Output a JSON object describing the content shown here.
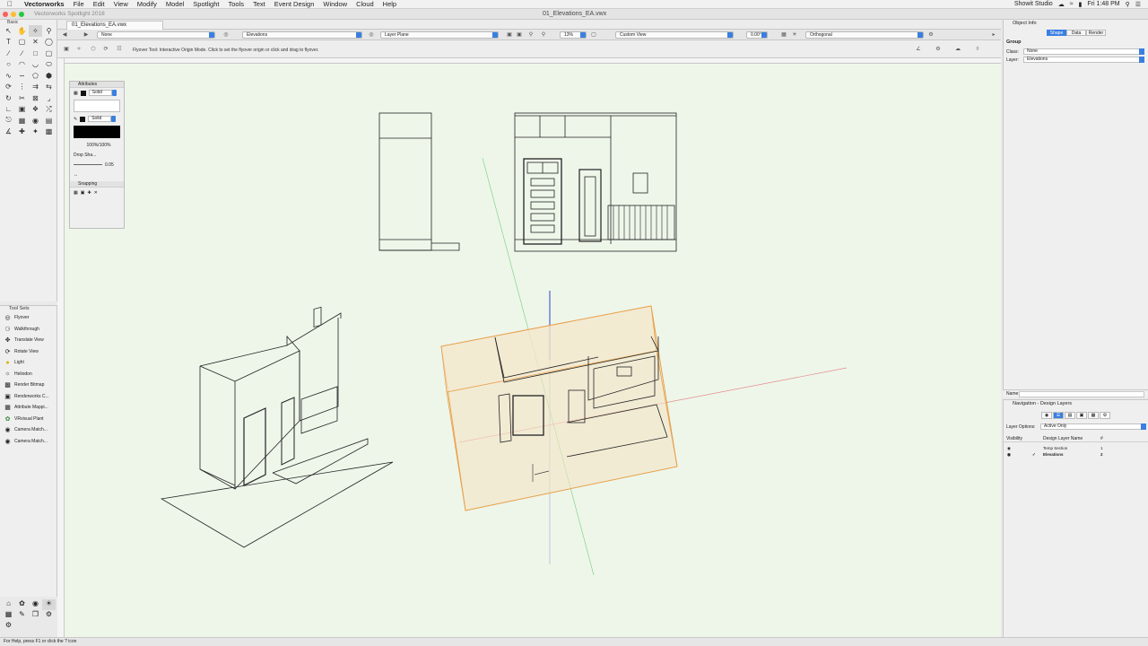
{
  "menubar": {
    "app": "Vectorworks",
    "items": [
      "File",
      "Edit",
      "View",
      "Modify",
      "Model",
      "Spotlight",
      "Tools",
      "Text",
      "Event Design",
      "Window",
      "Cloud",
      "Help"
    ],
    "clock": "Fri 1:48 PM",
    "status_text": "Showit Studio"
  },
  "titlebar": {
    "sidebar_title": "Vectorworks Spotlight 2018",
    "doc_title": "01_Elevations_EA.vwx"
  },
  "tools": {
    "header": "Basic"
  },
  "toolsets": {
    "header": "Tool Sets",
    "items": [
      "Flyover",
      "Walkthrough",
      "Translate View",
      "Rotate View",
      "Light",
      "Heliodon",
      "Render Bitmap",
      "Renderworks C...",
      "Attribute Mappi...",
      "VRvisual Plant",
      "Camera Match...",
      "Camera Match..."
    ]
  },
  "tab": {
    "label": "01_Elevations_EA.vwx"
  },
  "viewbar": {
    "class_value": "None",
    "layer_value": "Elevations",
    "plane_value": "Layer Plane",
    "zoom_value": "13%",
    "view_value": "Custom View",
    "rotation_value": "0.00°",
    "projection_value": "Orthogonal"
  },
  "modebar": {
    "help_text": "Flyover Tool: Interactive Origin Mode. Click to set the flyover origin or click and drag to flyover."
  },
  "attributes": {
    "title": "Attributes",
    "fill_label": "Solid",
    "pen_label": "Solid",
    "opacity": "100%/100%",
    "drop_shadow": "Drop Sha...",
    "line_value": "0.05",
    "snapping_title": "Snapping"
  },
  "object_info": {
    "title": "Object Info",
    "tabs": [
      "Shape",
      "Data",
      "Render"
    ],
    "active_tab": "Shape",
    "group_label": "Group",
    "class_label": "Class:",
    "class_value": "None",
    "layer_label": "Layer:",
    "layer_value": "Elevations",
    "name_label": "Name:"
  },
  "navigation": {
    "title": "Navigation - Design Layers",
    "layer_options_label": "Layer Options:",
    "layer_options_value": "Active Only",
    "col_visibility": "Visibility",
    "col_name": "Design Layer Name",
    "col_num": "#",
    "layers": [
      {
        "name": "Temp Section",
        "num": "1",
        "active": false
      },
      {
        "name": "Elevations",
        "num": "2",
        "active": true
      }
    ]
  },
  "status_bar": {
    "text": "For Help, press F1 or click the ? icon"
  },
  "colors": {
    "accent": "#3a7fe0",
    "canvas": "#eef6ea",
    "bbox": "#e8a04a"
  }
}
